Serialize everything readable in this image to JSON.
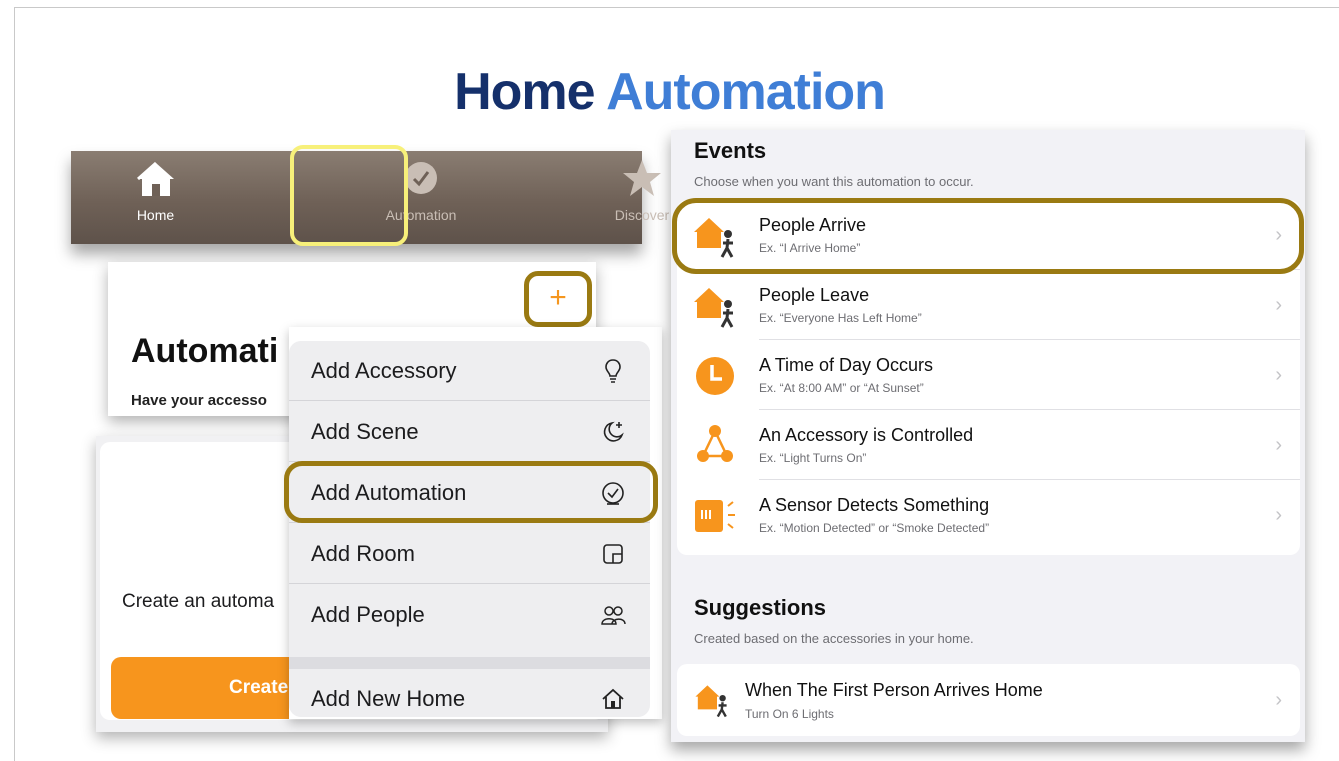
{
  "title": {
    "part1": "Home ",
    "part2": "Automation"
  },
  "tabbar": {
    "tabs": [
      {
        "label": "Home",
        "icon": "house-icon"
      },
      {
        "label": "Automation",
        "icon": "clock-icon"
      },
      {
        "label": "Discover",
        "icon": "star-icon"
      }
    ]
  },
  "automation_card": {
    "heading": "Automati",
    "subtitle": "Have your accesso",
    "add_button": "+"
  },
  "create_card": {
    "text": "Create an automa",
    "button_label": "Create"
  },
  "menu": {
    "items": [
      {
        "label": "Add Accessory",
        "icon": "lightbulb-icon"
      },
      {
        "label": "Add Scene",
        "icon": "scene-moon-icon"
      },
      {
        "label": "Add Automation",
        "icon": "clock-icon"
      },
      {
        "label": "Add Room",
        "icon": "room-icon"
      },
      {
        "label": "Add People",
        "icon": "people-icon"
      },
      {
        "label": "Add New Home",
        "icon": "house-icon"
      }
    ]
  },
  "events": {
    "heading": "Events",
    "subheading": "Choose when you want this automation to occur.",
    "items": [
      {
        "title": "People Arrive",
        "subtitle": "Ex. “I Arrive Home”",
        "icon": "people-arrive-icon"
      },
      {
        "title": "People Leave",
        "subtitle": "Ex. “Everyone Has Left Home”",
        "icon": "people-leave-icon"
      },
      {
        "title": "A Time of Day Occurs",
        "subtitle": "Ex. “At 8:00 AM” or “At Sunset”",
        "icon": "clock-icon"
      },
      {
        "title": "An Accessory is Controlled",
        "subtitle": "Ex. “Light Turns On”",
        "icon": "accessory-network-icon"
      },
      {
        "title": "A Sensor Detects Something",
        "subtitle": "Ex. “Motion Detected” or “Smoke Detected”",
        "icon": "sensor-icon"
      }
    ]
  },
  "suggestions": {
    "heading": "Suggestions",
    "subheading": "Created based on the accessories in your home.",
    "items": [
      {
        "title": "When The First Person Arrives Home",
        "subtitle": "Turn On 6 Lights",
        "icon": "people-arrive-icon"
      }
    ]
  },
  "colors": {
    "accent": "#f7951d",
    "highlight": "#9a7a12",
    "tab_highlight": "#f7f07a",
    "title_dark": "#15306b",
    "title_light": "#3f7ed6"
  }
}
